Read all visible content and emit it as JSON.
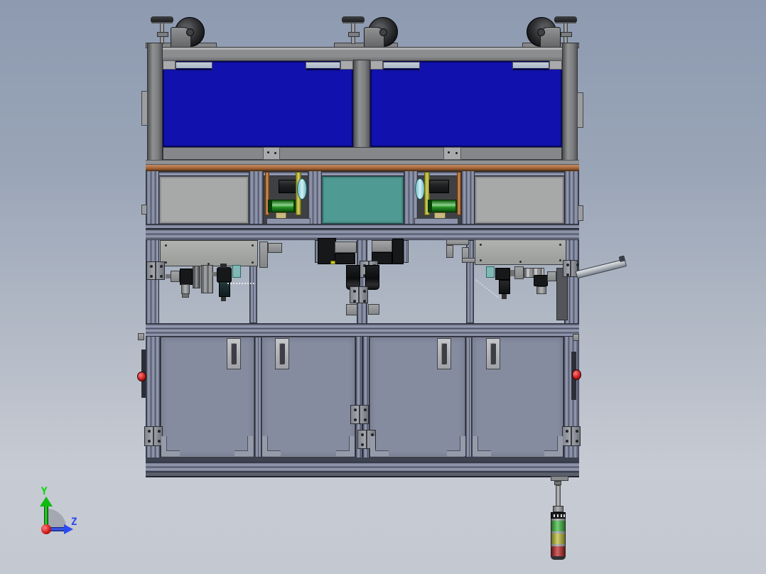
{
  "viewport": {
    "background_top": "#8d9ab0",
    "background_bottom": "#c7cbd3"
  },
  "orientation_triad": {
    "y_label": "Y",
    "z_label": "Z",
    "y_axis_color": "#00d800",
    "z_axis_color": "#2b4bf2",
    "origin_marker_color": "#d42020"
  },
  "machine": {
    "frame_color": "#85878a",
    "extrusion_color": "#7d849b",
    "upper_panel_color": "#1111ae",
    "tabletop_color": "#b06a38",
    "side_panel_color": "#a7a9a8",
    "teal_panel_color": "#4f9a93",
    "door_color": "#868ca0",
    "roller_color": "#2fae2f",
    "bracket_yellow_color": "#c2c22a",
    "bracket_orange_color": "#c87428",
    "estop_color": "#cc2222"
  },
  "signal_tower": {
    "segments": [
      {
        "name": "green",
        "color": "#3cba3c"
      },
      {
        "name": "yellow",
        "color": "#bcbc34"
      },
      {
        "name": "red",
        "color": "#bb2222"
      }
    ]
  }
}
